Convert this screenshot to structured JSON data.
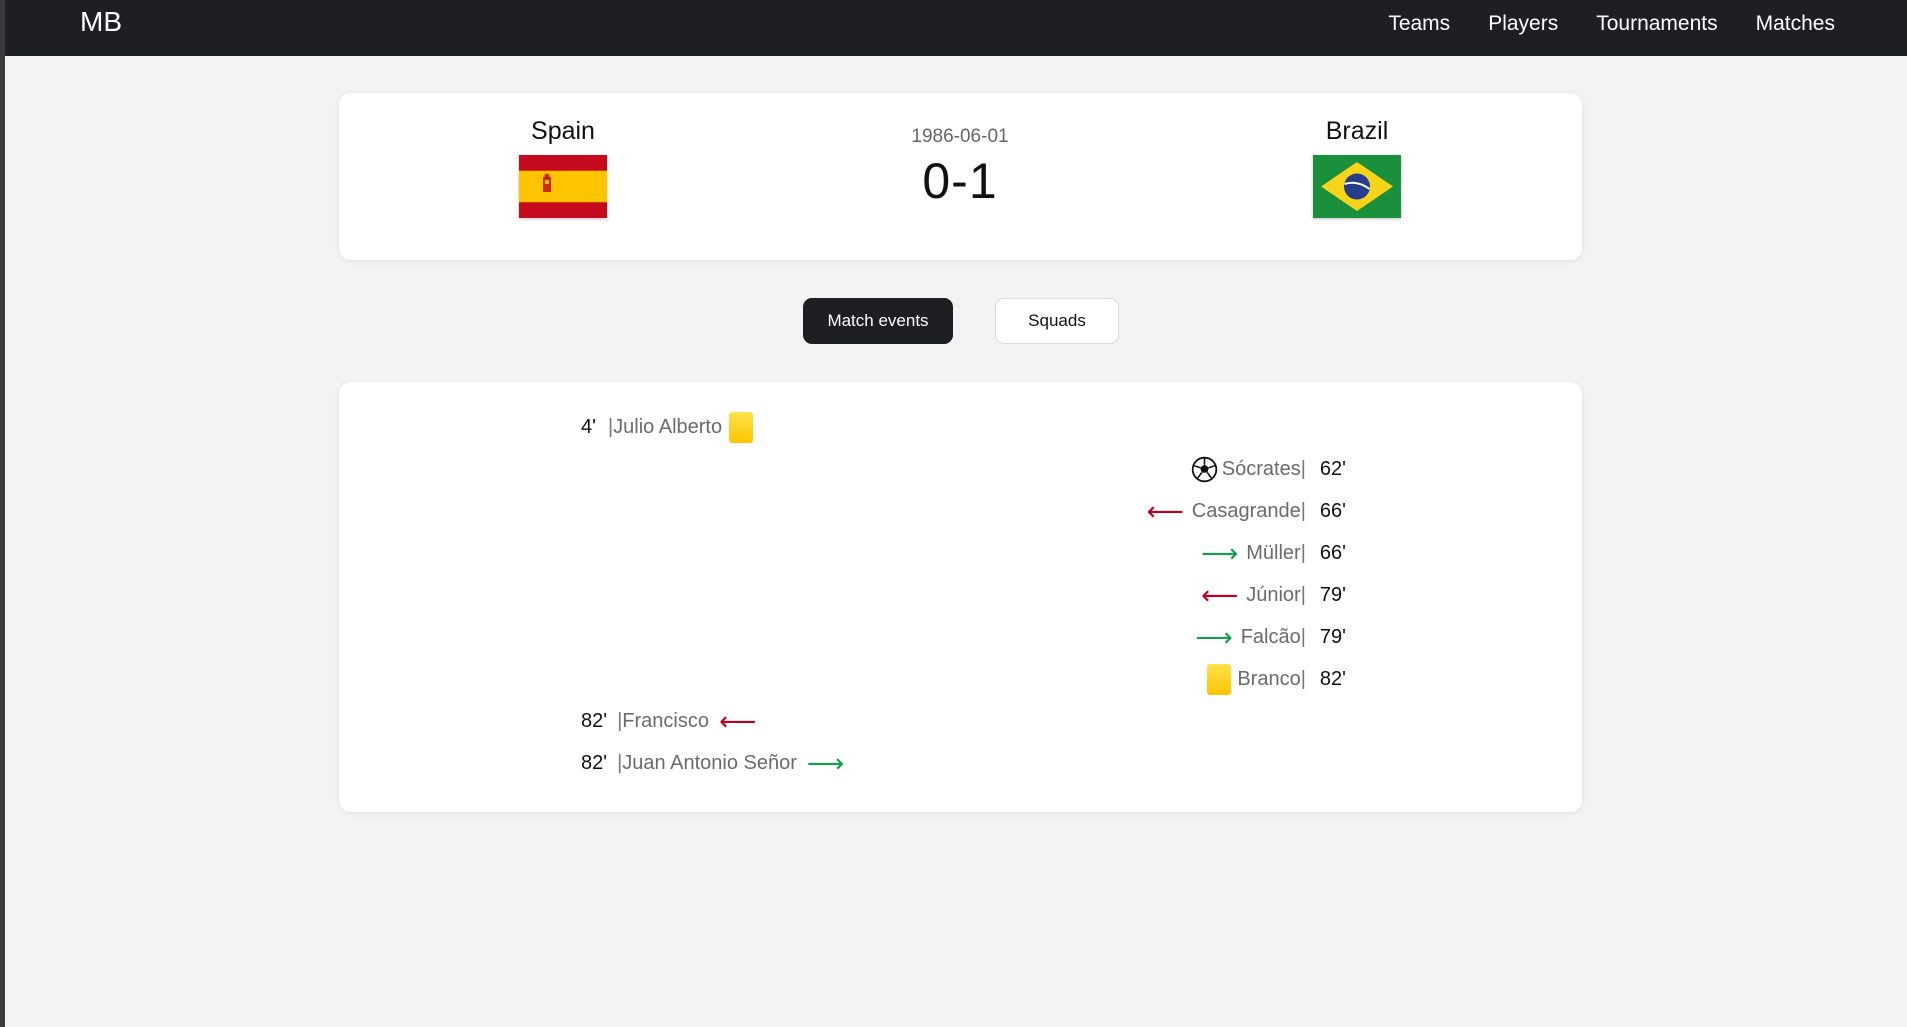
{
  "nav": {
    "brand": "MB",
    "links": [
      "Teams",
      "Players",
      "Tournaments",
      "Matches"
    ]
  },
  "match": {
    "home_team": "Spain",
    "away_team": "Brazil",
    "date": "1986-06-01",
    "score": "0-1"
  },
  "tabs": {
    "events": "Match events",
    "squads": "Squads"
  },
  "events": [
    {
      "side": "home",
      "minute": "4'",
      "player": "Julio Alberto",
      "type": "yellow-card-icon"
    },
    {
      "side": "away",
      "minute": "62'",
      "player": "Sócrates",
      "type": "soccer-ball-icon"
    },
    {
      "side": "away",
      "minute": "66'",
      "player": "Casagrande",
      "type": "substitution-out-arrow-icon"
    },
    {
      "side": "away",
      "minute": "66'",
      "player": "Müller",
      "type": "substitution-in-arrow-icon"
    },
    {
      "side": "away",
      "minute": "79'",
      "player": "Júnior",
      "type": "substitution-out-arrow-icon"
    },
    {
      "side": "away",
      "minute": "79'",
      "player": "Falcão",
      "type": "substitution-in-arrow-icon"
    },
    {
      "side": "away",
      "minute": "82'",
      "player": "Branco",
      "type": "yellow-card-icon"
    },
    {
      "side": "home",
      "minute": "82'",
      "player": "Francisco",
      "type": "substitution-out-arrow-icon"
    },
    {
      "side": "home",
      "minute": "82'",
      "player": "Juan Antonio Señor",
      "type": "substitution-in-arrow-icon"
    }
  ],
  "colors": {
    "navbar": "#1d1f23",
    "page_bg": "#f3f3f3",
    "sub_out": "#c0001d",
    "sub_in": "#12a04a",
    "yellow_card": "#ffd21e"
  }
}
